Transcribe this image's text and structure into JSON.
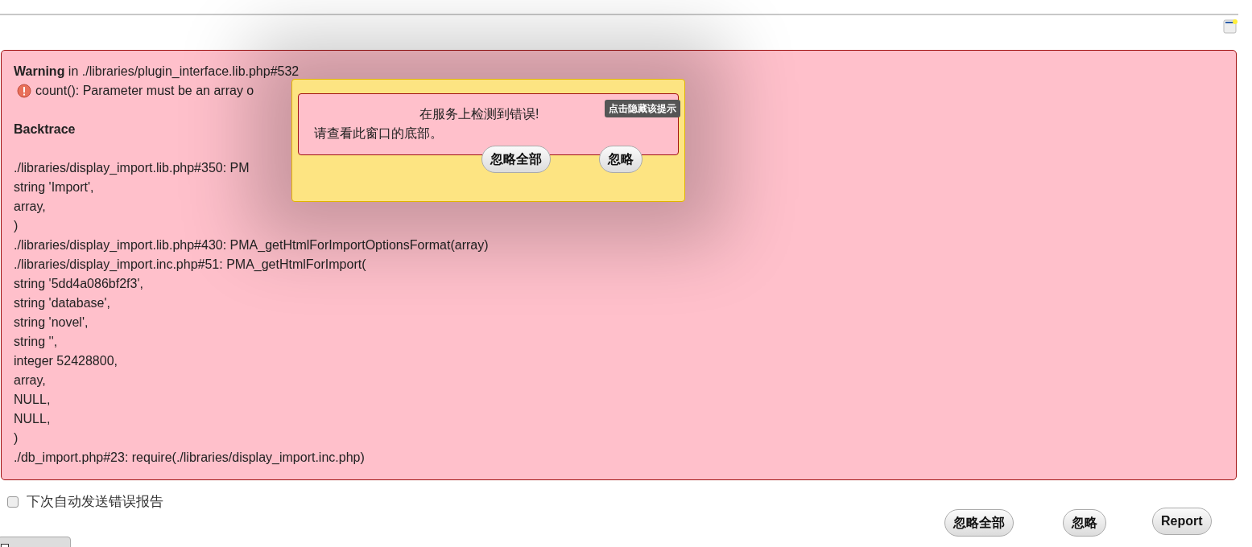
{
  "warning": {
    "heading": "**Warning** in ./libraries/plugin_interface.lib.php#532",
    "message": "count(): Parameter must be an array o"
  },
  "backtrace": {
    "title": "Backtrace",
    "lines": [
      "./libraries/display_import.lib.php#350: PM",
      "string 'Import',",
      "array,",
      ")",
      "./libraries/display_import.lib.php#430: PMA_getHtmlForImportOptionsFormat(array)",
      "./libraries/display_import.inc.php#51: PMA_getHtmlForImport(",
      "string '5dd4a086bf2f3',",
      "string 'database',",
      "string 'novel',",
      "string '',",
      "integer 52428800,",
      "array,",
      "NULL,",
      "NULL,",
      ")",
      "./db_import.php#23: require(./libraries/display_import.inc.php)"
    ]
  },
  "popup": {
    "title": "在服务上检测到错误!",
    "message": "请查看此窗口的底部。",
    "buttons": [
      "忽略全部",
      "忽略"
    ],
    "tooltip": "点击隐藏该提示"
  },
  "auto_report": {
    "label": "下次自动发送错误报告",
    "checked": false
  },
  "buttons": [
    "忽略全部",
    "忽略",
    "Report"
  ]
}
